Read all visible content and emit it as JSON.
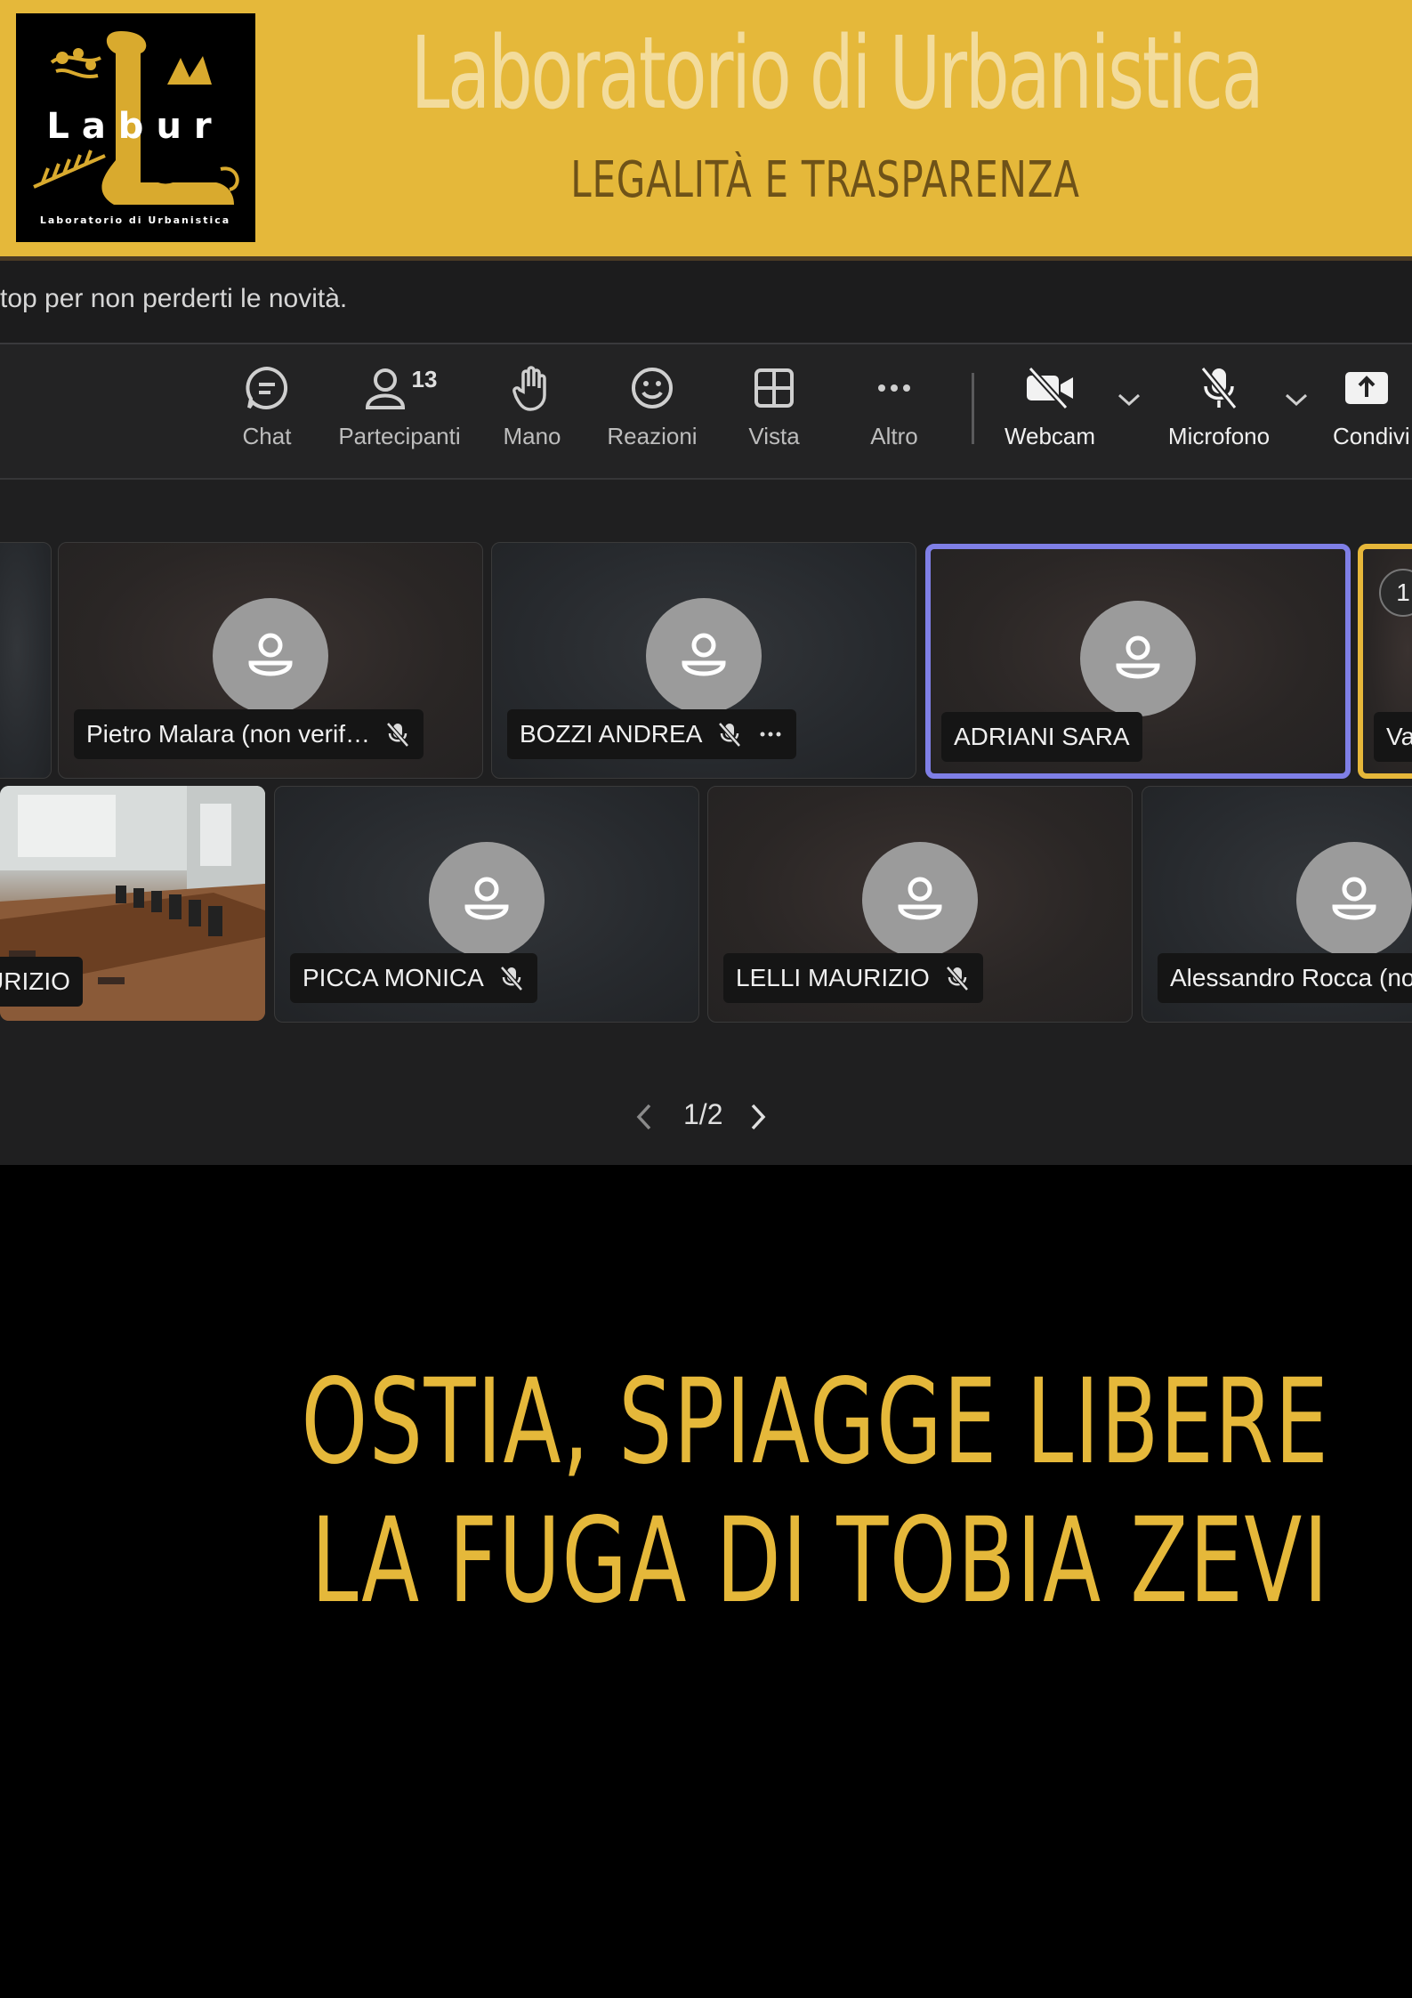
{
  "header": {
    "logo": {
      "name": "Labur",
      "caption": "Laboratorio di Urbanistica"
    },
    "title": "Laboratorio di Urbanistica",
    "subtitle": "LEGALITÀ E TRASPARENZA"
  },
  "meeting": {
    "banner_text": "top per non perderti le novità.",
    "toolbar": [
      {
        "label": "Chat",
        "icon": "chat-icon"
      },
      {
        "label": "Partecipanti",
        "icon": "person-icon",
        "badge": "13"
      },
      {
        "label": "Mano",
        "icon": "hand-icon"
      },
      {
        "label": "Reazioni",
        "icon": "smiley-icon"
      },
      {
        "label": "Vista",
        "icon": "grid-icon"
      },
      {
        "label": "Altro",
        "icon": "more-icon"
      },
      {
        "label": "Webcam",
        "icon": "camera-off-icon"
      },
      {
        "label": "Microfono",
        "icon": "mic-off-icon"
      },
      {
        "label": "Condivi",
        "icon": "share-icon"
      }
    ],
    "row1": [
      {
        "name": "Pietro Malara (non verif…"
      },
      {
        "name": "BOZZI ANDREA"
      },
      {
        "name": "ADRIANI SARA"
      },
      {
        "name": "Va",
        "badge": "1"
      }
    ],
    "row2": [
      {
        "name": "URIZIO"
      },
      {
        "name": "PICCA MONICA"
      },
      {
        "name": "LELLI MAURIZIO"
      },
      {
        "name": "Alessandro Rocca (no"
      }
    ],
    "page_indicator": "1/2"
  },
  "headline": {
    "line1": "OSTIA, SPIAGGE LIBERE",
    "line2": "LA FUGA DI TOBIA ZEVI"
  },
  "colors": {
    "accent": "#e5b83a",
    "selected": "#7f7fe6"
  }
}
